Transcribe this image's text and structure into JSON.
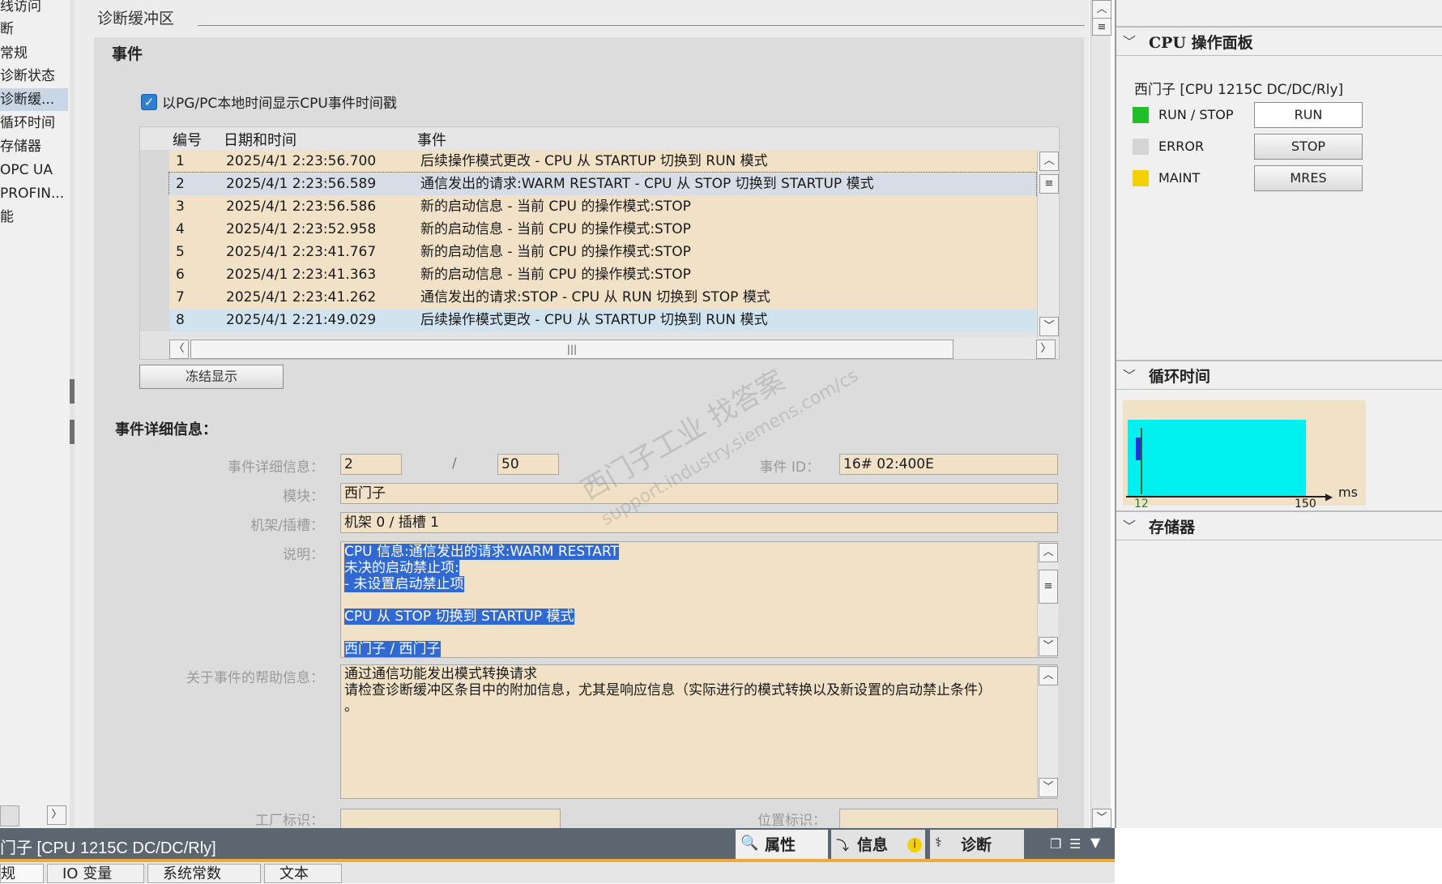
{
  "left_nav": {
    "items": [
      {
        "label": "线访问",
        "selected": false
      },
      {
        "label": "断",
        "selected": false
      },
      {
        "label": "常规",
        "selected": false
      },
      {
        "label": "诊断状态",
        "selected": false
      },
      {
        "label": "诊断缓...",
        "selected": true
      },
      {
        "label": "循环时间",
        "selected": false
      },
      {
        "label": "存储器",
        "selected": false
      },
      {
        "label": "OPC UA",
        "selected": false
      },
      {
        "label": "PROFIN...",
        "selected": false
      },
      {
        "label": "能",
        "selected": false
      }
    ],
    "scroll_right": "〉"
  },
  "main": {
    "section_title": "诊断缓冲区",
    "events_heading": "事件",
    "checkbox": {
      "checked": true,
      "label": "以PG/PC本地时间显示CPU事件时间戳"
    },
    "table": {
      "headers": [
        "编号",
        "日期和时间",
        "事件"
      ],
      "rows": [
        {
          "num": "1",
          "datetime": "2025/4/1 2:23:56.700",
          "event": "后续操作模式更改  - CPU 从 STARTUP 切换到 RUN 模式",
          "style": "tan"
        },
        {
          "num": "2",
          "datetime": "2025/4/1 2:23:56.589",
          "event": "通信发出的请求:WARM RESTART  - CPU 从 STOP 切换到 STARTUP 模式",
          "style": "selected"
        },
        {
          "num": "3",
          "datetime": "2025/4/1 2:23:56.586",
          "event": "新的启动信息 - 当前 CPU 的操作模式:STOP",
          "style": "tan"
        },
        {
          "num": "4",
          "datetime": "2025/4/1 2:23:52.958",
          "event": "新的启动信息 - 当前 CPU 的操作模式:STOP",
          "style": "tan"
        },
        {
          "num": "5",
          "datetime": "2025/4/1 2:23:41.767",
          "event": "新的启动信息 - 当前 CPU 的操作模式:STOP",
          "style": "tan"
        },
        {
          "num": "6",
          "datetime": "2025/4/1 2:23:41.363",
          "event": "新的启动信息 - 当前 CPU 的操作模式:STOP",
          "style": "tan"
        },
        {
          "num": "7",
          "datetime": "2025/4/1 2:23:41.262",
          "event": "通信发出的请求:STOP  - CPU 从 RUN 切换到 STOP 模式",
          "style": "tan"
        },
        {
          "num": "8",
          "datetime": "2025/4/1 2:21:49.029",
          "event": "后续操作模式更改  - CPU 从 STARTUP 切换到 RUN 模式",
          "style": "blue"
        }
      ]
    },
    "freeze_button": "冻结显示",
    "details_heading": "事件详细信息：",
    "details": {
      "detail_label": "事件详细信息：",
      "detail_index": "2",
      "separator": "/",
      "detail_total": "50",
      "event_id_label": "事件 ID：",
      "event_id": "16# 02:400E",
      "module_label": "模块：",
      "module": "西门子",
      "rack_label": "机架/插槽：",
      "rack": "机架 0 / 插槽 1",
      "desc_label": "说明：",
      "desc_lines": [
        "CPU 信息:通信发出的请求:WARM RESTART ",
        "未决的启动禁止项:",
        " - 未设置启动禁止项",
        "",
        " CPU 从 STOP 切换到 STARTUP 模式",
        "",
        " 西门子 / 西门子"
      ],
      "help_label": "关于事件的帮助信息：",
      "help_lines": [
        "通过通信功能发出模式转换请求",
        "请检查诊断缓冲区条目中的附加信息，尤其是响应信息（实际进行的模式转换以及新设置的启动禁止条件）",
        "。"
      ],
      "plant_label": "工厂标识：",
      "location_label": "位置标识："
    },
    "watermark_line1": "西门子工业  找答案",
    "watermark_line2": "support.industry.siemens.com/cs"
  },
  "right_panel": {
    "cpu_section_title": "CPU 操作面板",
    "cpu_name": "西门子 [CPU 1215C DC/DC/Rly]",
    "leds": [
      {
        "label": "RUN / STOP",
        "color": "#1fbf2a"
      },
      {
        "label": "ERROR",
        "color": "#d4d4d4"
      },
      {
        "label": "MAINT",
        "color": "#f5d000"
      }
    ],
    "buttons": [
      "RUN",
      "STOP",
      "MRES"
    ],
    "cycle_section_title": "循环时间",
    "cycle_chart": {
      "unit": "ms",
      "tick_left": "12",
      "tick_right": "150"
    },
    "memory_section_title": "存储器"
  },
  "bottom": {
    "device_title": "门子 [CPU 1215C DC/DC/Rly]",
    "tabs": [
      "属性",
      "信息",
      "诊断"
    ],
    "sub_tabs": [
      "规",
      "IO 变量",
      "系统常数",
      "文本"
    ]
  }
}
